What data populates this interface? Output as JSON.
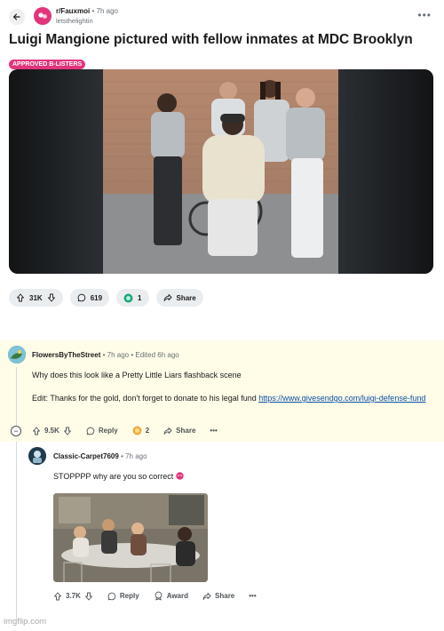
{
  "post": {
    "subreddit": "r/Fauxmoi",
    "time": "7h ago",
    "username": "letsthelightin",
    "title": "Luigi Mangione pictured with fellow inmates at MDC Brooklyn",
    "flair": "APPROVED B-LISTERS",
    "flair_color": "#e2347b",
    "votes": "31K",
    "comments": "619",
    "awards": "1",
    "share": "Share",
    "more": "•••"
  },
  "comment1": {
    "author": "FlowersByTheStreet",
    "time": "7h ago",
    "edited": "Edited 6h ago",
    "text1": "Why does this look like a Pretty Little Liars flashback scene",
    "edit_prefix": "Edit: Thanks for the gold, don't forget to donate to his legal fund ",
    "link": "https://www.givesendgo.com/luigi-defense-fund",
    "votes": "9.5K",
    "reply": "Reply",
    "awards": "2",
    "share": "Share",
    "more": "•••",
    "collapse": "−"
  },
  "comment2": {
    "author": "Classic-Carpet7609",
    "time": "7h ago",
    "text": "STOPPPP why are you so correct",
    "votes": "3.7K",
    "reply": "Reply",
    "award": "Award",
    "share": "Share",
    "more": "•••"
  },
  "watermark": "imgflip.com",
  "colors": {
    "highlight": "#fffce8",
    "link": "#0a4ea6",
    "pill": "#eaedef"
  }
}
